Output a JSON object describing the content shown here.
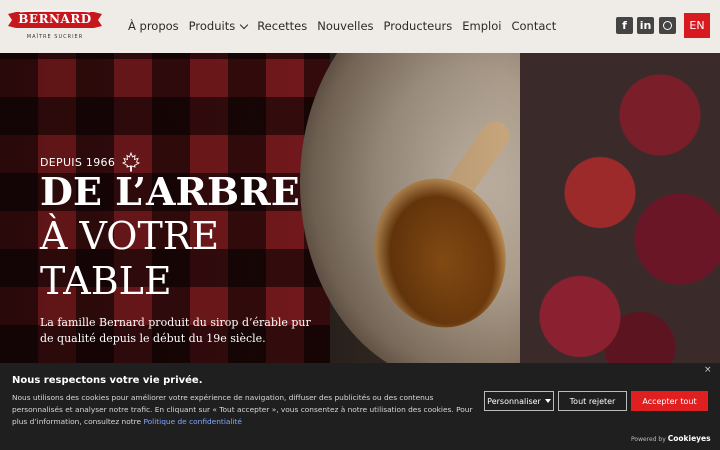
{
  "brand": {
    "name": "BERNARD",
    "tagline": "MAÎTRE SUCRIER"
  },
  "nav": [
    {
      "label": "À propos"
    },
    {
      "label": "Produits"
    },
    {
      "label": "Recettes"
    },
    {
      "label": "Nouvelles"
    },
    {
      "label": "Producteurs"
    },
    {
      "label": "Emploi"
    },
    {
      "label": "Contact"
    }
  ],
  "social": {
    "facebook": "f",
    "linkedin": "in"
  },
  "language": "EN",
  "hero": {
    "since": "DEPUIS 1966",
    "line1": "DE L’ARBRE",
    "line2": "À VOTRE",
    "line3": "TABLE",
    "lead": "La famille Bernard produit du sirop d’érable pur de qualité depuis le début du 19e siècle."
  },
  "cookie": {
    "title": "Nous respectons votre vie privée.",
    "text": "Nous utilisons des cookies pour améliorer votre expérience de navigation, diffuser des publicités ou des contenus personnalisés et analyser notre trafic. En cliquant sur « Tout accepter », vous consentez à notre utilisation des cookies.  Pour plus d’information, consultez notre ",
    "link": "Politique de confidentialité",
    "close": "×",
    "customize": "Personnaliser",
    "reject": "Tout rejeter",
    "accept": "Accepter tout",
    "powered_prefix": "Powered by",
    "powered_brand": "Cookieyes"
  },
  "colors": {
    "accent": "#d71920",
    "header_bg": "#efece8",
    "cookie_bg": "#1f1f1f"
  }
}
